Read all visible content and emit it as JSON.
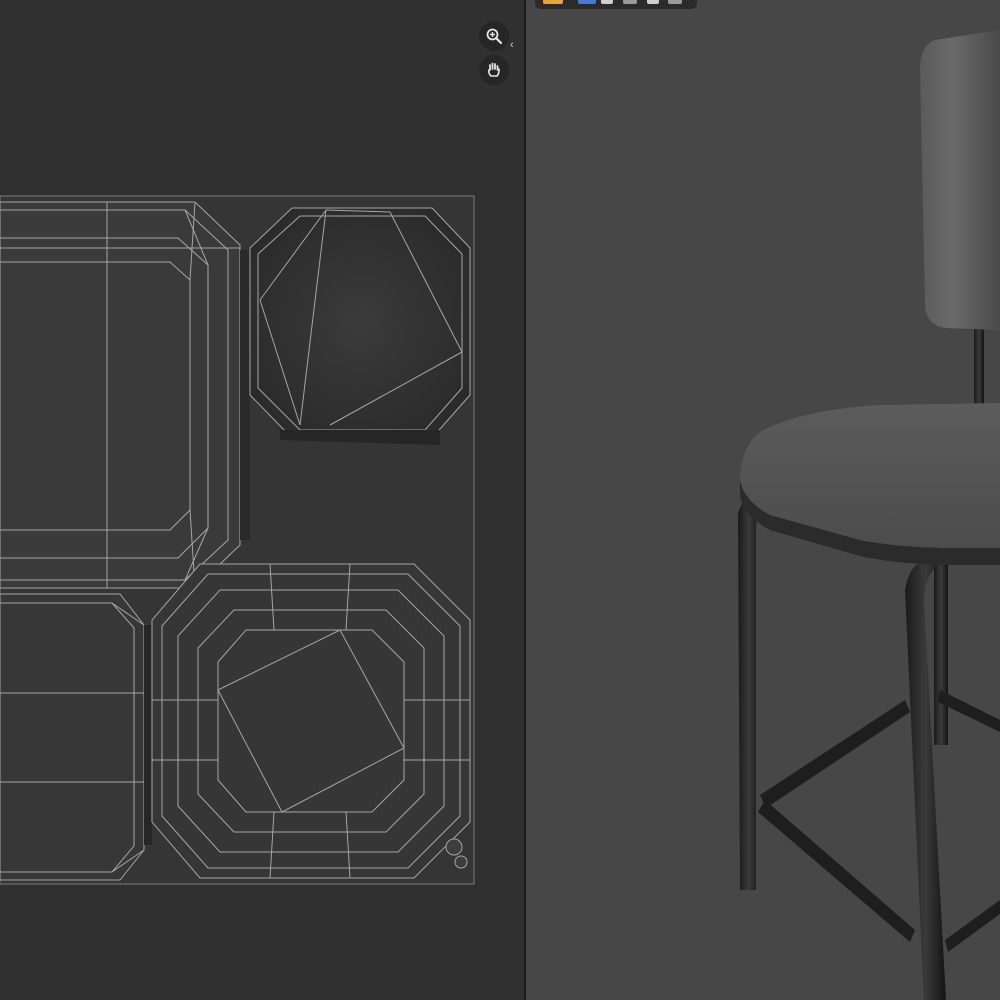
{
  "uv_editor": {
    "navigation": {
      "zoom_icon": "zoom-in-icon",
      "pan_icon": "hand-pan-icon",
      "sidebar_icons": [
        "chevron-left-icon",
        "chevron-right-icon"
      ]
    }
  },
  "viewport_header": {
    "icons": [
      "select-box-icon",
      "mode-icon",
      "overlay-icon",
      "shading-icon",
      "shading-dropdown-icon"
    ]
  },
  "colors": {
    "uv_background": "#303030",
    "viewport_background": "#474747",
    "uv_wire": "#a8a8a8",
    "header_accent_orange": "#e8a33a",
    "header_accent_blue": "#4a78d6"
  },
  "glyphs": {
    "chevron_left": "‹",
    "chevron_right": "›"
  }
}
